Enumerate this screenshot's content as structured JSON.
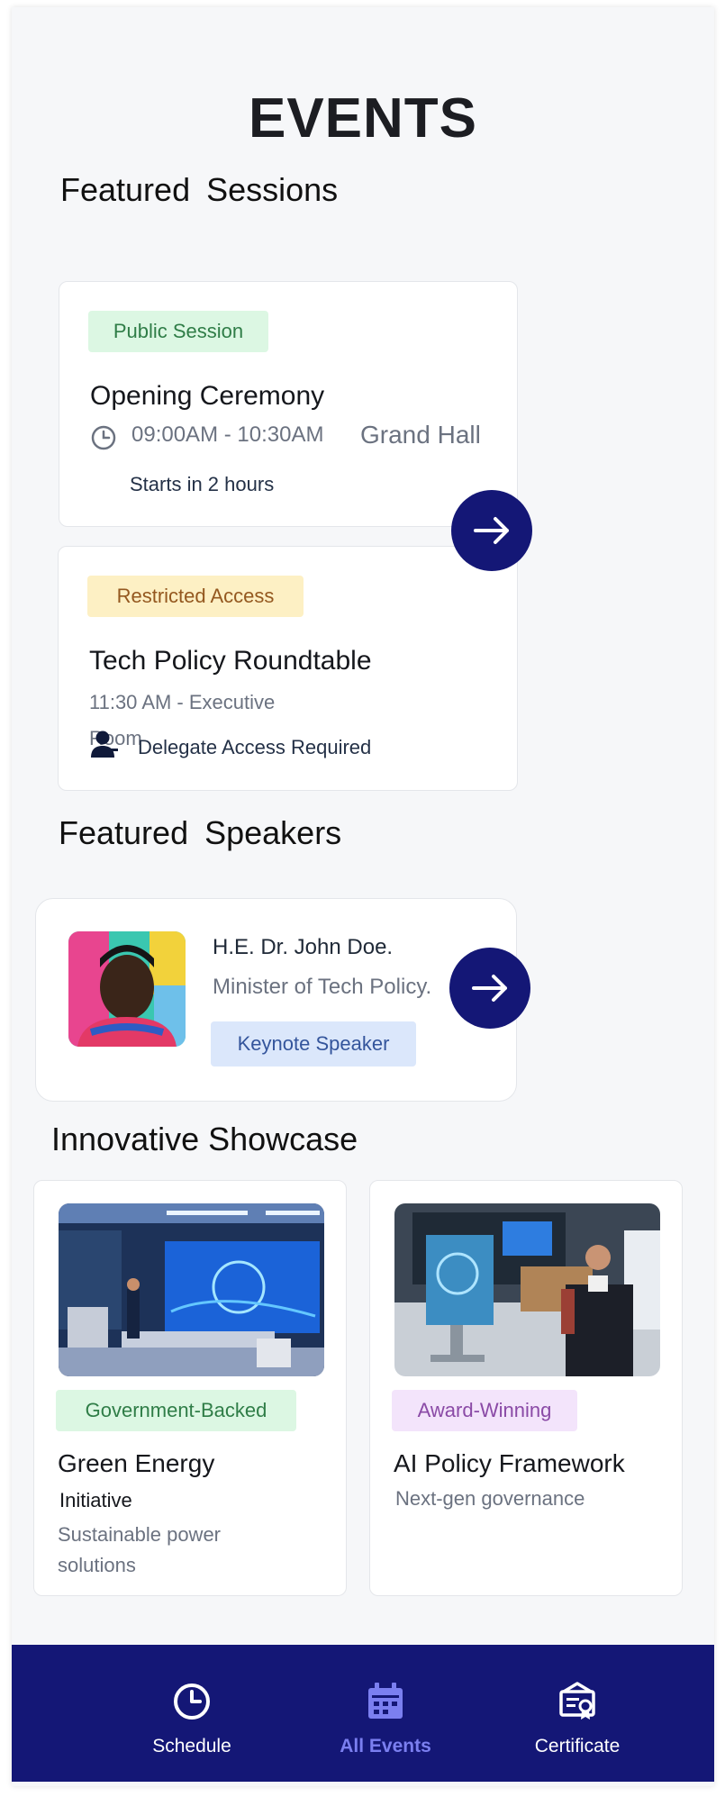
{
  "page": {
    "title": "EVENTS"
  },
  "sections": {
    "sessions": "Featured Sessions",
    "speakers": "Featured Speakers",
    "showcase": "Innovative Showcase"
  },
  "sessions": [
    {
      "badge": "Public Session",
      "title": "Opening Ceremony",
      "time": "09:00AM - 10:30AM",
      "location": "Grand Hall",
      "status": "Starts in 2 hours"
    },
    {
      "badge": "Restricted Access",
      "title": "Tech Policy Roundtable",
      "time_line1": "11:30 AM - Executive",
      "time_line2": "Room",
      "note": "Delegate Access Required"
    }
  ],
  "speaker": {
    "name": "H.E. Dr. John Doe.",
    "role": "Minister of Tech Policy.",
    "badge": "Keynote Speaker"
  },
  "showcase": [
    {
      "badge": "Government-Backed",
      "title": "Green Energy",
      "subtitle": "Initiative",
      "desc_line1": "Sustainable power",
      "desc_line2": "solutions"
    },
    {
      "badge": "Award-Winning",
      "title": "AI Policy Framework",
      "desc": "Next-gen governance"
    }
  ],
  "nav": [
    {
      "label": "Schedule",
      "icon": "clock-icon"
    },
    {
      "label": "All Events",
      "icon": "calendar-icon",
      "active": true
    },
    {
      "label": "Certificate",
      "icon": "certificate-icon"
    }
  ],
  "colors": {
    "navy": "#141776",
    "active_nav": "#7b7ff0",
    "public_badge": "#dcf7e3",
    "restricted_badge": "#fdf0c4",
    "keynote_badge": "#dbe7fb",
    "award_badge": "#f3e4fb"
  }
}
